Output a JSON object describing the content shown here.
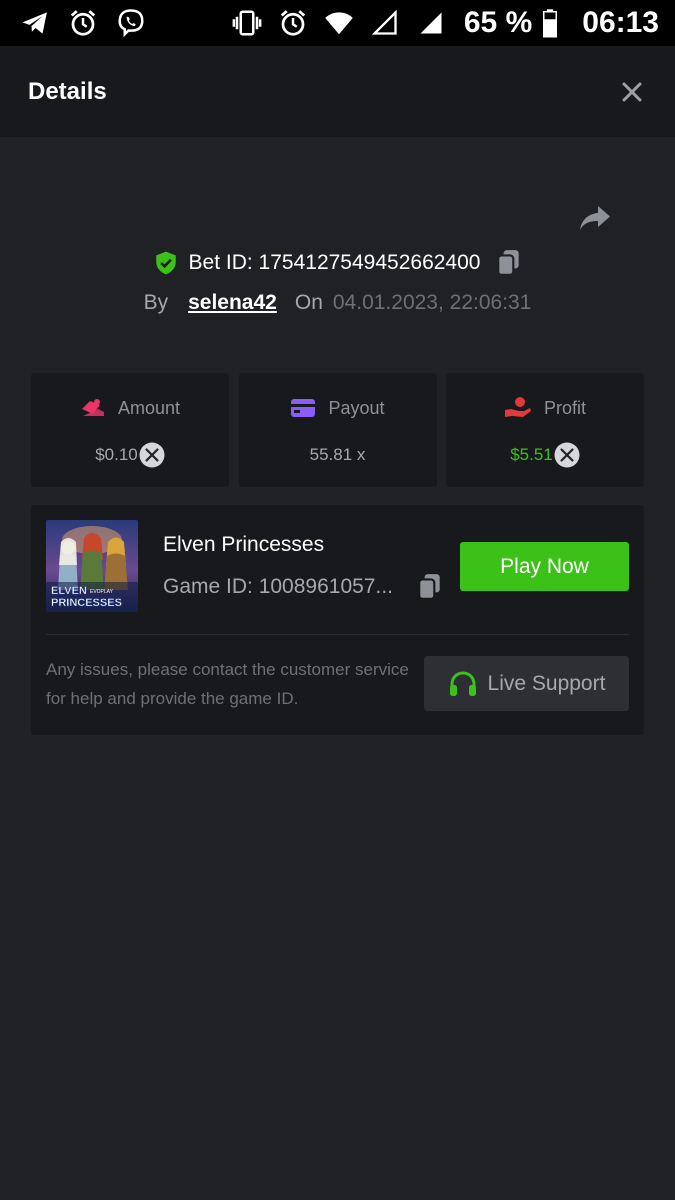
{
  "status_bar": {
    "left_icons": [
      "telegram-icon",
      "alarm-icon",
      "viber-icon"
    ],
    "right_icons": [
      "vibrate-icon",
      "alarm-icon",
      "wifi-icon",
      "signal-empty-icon",
      "signal-icon",
      "battery-icon"
    ],
    "battery": "65 %",
    "time": "06:13"
  },
  "header": {
    "title": "Details"
  },
  "bet": {
    "id_text": "Bet ID: 1754127549452662400",
    "by_label": "By",
    "username": "selena42",
    "on_label": "On",
    "datetime": "04.01.2023, 22:06:31"
  },
  "stats": [
    {
      "label": "Amount",
      "value": "$0.10",
      "icon": "wager-icon",
      "icon_color": "#e8346a",
      "value_color": "#a6a8ad",
      "has_coin": true
    },
    {
      "label": "Payout",
      "value": "55.81 x",
      "icon": "payout-card-icon",
      "icon_color": "#8b5cf6",
      "value_color": "#a6a8ad",
      "has_coin": false
    },
    {
      "label": "Profit",
      "value": "$5.51",
      "icon": "profit-hand-icon",
      "icon_color": "#e03a3a",
      "value_color": "#3bc117",
      "has_coin": true
    }
  ],
  "game": {
    "name": "Elven Princesses",
    "id_text": "Game ID: 1008961057...",
    "thumb_title_line1": "ELVEN",
    "thumb_title_line2": "PRINCESSES",
    "thumb_brand": "EVOPLAY",
    "play_label": "Play Now",
    "help_text": "Any issues, please contact the customer service for help and provide the game ID.",
    "support_label": "Live Support"
  },
  "colors": {
    "background": "#202125",
    "card": "#18191c",
    "accent_green": "#3bc117",
    "muted_text": "#a6a8ad"
  }
}
